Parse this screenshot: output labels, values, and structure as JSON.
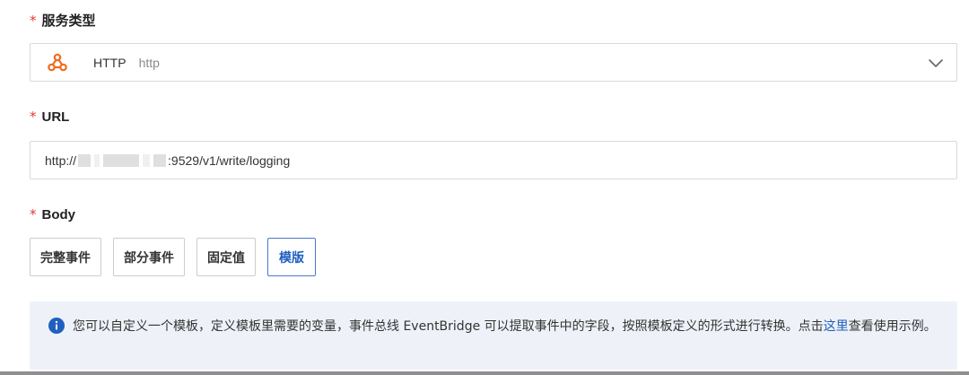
{
  "service_type": {
    "label": "服务类型",
    "required_mark": "*",
    "selected_icon": "webhook-icon",
    "selected_name": "HTTP",
    "selected_sub": "http"
  },
  "url": {
    "label": "URL",
    "required_mark": "*",
    "value_prefix": "http://",
    "value_suffix": ":9529/v1/write/logging"
  },
  "body": {
    "label": "Body",
    "required_mark": "*",
    "options": [
      "完整事件",
      "部分事件",
      "固定值",
      "模版"
    ],
    "selected": "模版"
  },
  "info": {
    "icon": "info-icon",
    "text_before_link": "您可以自定义一个模板，定义模板里需要的变量，事件总线 EventBridge 可以提取事件中的字段，按照模板定义的形式进行转换。点击",
    "link_text": "这里",
    "text_after_link": "查看使用示例。"
  },
  "colors": {
    "accent": "#1f5fbf",
    "required": "#e23b30",
    "icon_orange": "#f26b1d",
    "info_bg": "#eef2f8"
  }
}
